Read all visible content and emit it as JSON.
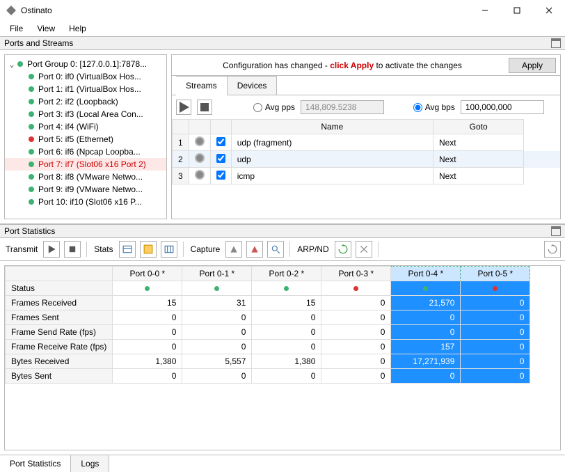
{
  "app": {
    "title": "Ostinato"
  },
  "menu": [
    "File",
    "View",
    "Help"
  ],
  "panels": {
    "ports_streams": "Ports and Streams",
    "port_stats": "Port Statistics"
  },
  "tree": {
    "group": "Port Group 0:  [127.0.0.1]:7878...",
    "ports": [
      {
        "label": "Port 0: if0 (VirtualBox Hos...",
        "status": "green"
      },
      {
        "label": "Port 1: if1 (VirtualBox Hos...",
        "status": "green"
      },
      {
        "label": "Port 2: if2 (Loopback)",
        "status": "green"
      },
      {
        "label": "Port 3: if3 (Local Area Con...",
        "status": "green"
      },
      {
        "label": "Port 4: if4 (WiFi)",
        "status": "green"
      },
      {
        "label": "Port 5: if5 (Ethernet)",
        "status": "red"
      },
      {
        "label": "Port 6: if6 (Npcap Loopba...",
        "status": "green"
      },
      {
        "label": "Port 7: if7 (Slot06 x16 Port 2)",
        "status": "green",
        "selected": true
      },
      {
        "label": "Port 8: if8 (VMware Netwo...",
        "status": "green"
      },
      {
        "label": "Port 9: if9 (VMware Netwo...",
        "status": "green"
      },
      {
        "label": "Port 10: if10 (Slot06 x16 P...",
        "status": "green"
      }
    ]
  },
  "config": {
    "message_pre": "Configuration has changed - ",
    "message_em": "click Apply",
    "message_post": " to activate the changes",
    "apply": "Apply"
  },
  "tabs": {
    "streams": "Streams",
    "devices": "Devices"
  },
  "rate": {
    "avg_pps_label": "Avg pps",
    "avg_pps_value": "148,809.5238",
    "avg_bps_label": "Avg bps",
    "avg_bps_value": "100,000,000",
    "selected": "bps"
  },
  "stream_table": {
    "headers": {
      "name": "Name",
      "goto": "Goto"
    },
    "rows": [
      {
        "idx": "1",
        "enabled": true,
        "name": "udp (fragment)",
        "goto": "Next"
      },
      {
        "idx": "2",
        "enabled": true,
        "name": "udp",
        "goto": "Next",
        "selected": true
      },
      {
        "idx": "3",
        "enabled": true,
        "name": "icmp",
        "goto": "Next"
      }
    ]
  },
  "toolbar": {
    "transmit": "Transmit",
    "stats": "Stats",
    "capture": "Capture",
    "arp": "ARP/ND"
  },
  "stats": {
    "columns": [
      "Port 0-0 *",
      "Port 0-1 *",
      "Port 0-2 *",
      "Port 0-3 *",
      "Port 0-4 *",
      "Port 0-5 *"
    ],
    "selected_cols": [
      4,
      5
    ],
    "status_colors": [
      "green",
      "green",
      "green",
      "red",
      "green",
      "red"
    ],
    "rows": [
      {
        "label": "Status"
      },
      {
        "label": "Frames Received",
        "vals": [
          "15",
          "31",
          "15",
          "0",
          "21,570",
          "0"
        ]
      },
      {
        "label": "Frames Sent",
        "vals": [
          "0",
          "0",
          "0",
          "0",
          "0",
          "0"
        ]
      },
      {
        "label": "Frame Send Rate (fps)",
        "vals": [
          "0",
          "0",
          "0",
          "0",
          "0",
          "0"
        ]
      },
      {
        "label": "Frame Receive Rate (fps)",
        "vals": [
          "0",
          "0",
          "0",
          "0",
          "157",
          "0"
        ]
      },
      {
        "label": "Bytes Received",
        "vals": [
          "1,380",
          "5,557",
          "1,380",
          "0",
          "17,271,939",
          "0"
        ]
      },
      {
        "label": "Bytes Sent",
        "vals": [
          "0",
          "0",
          "0",
          "0",
          "0",
          "0"
        ]
      }
    ]
  },
  "bottom_tabs": {
    "port_stats": "Port Statistics",
    "logs": "Logs"
  }
}
